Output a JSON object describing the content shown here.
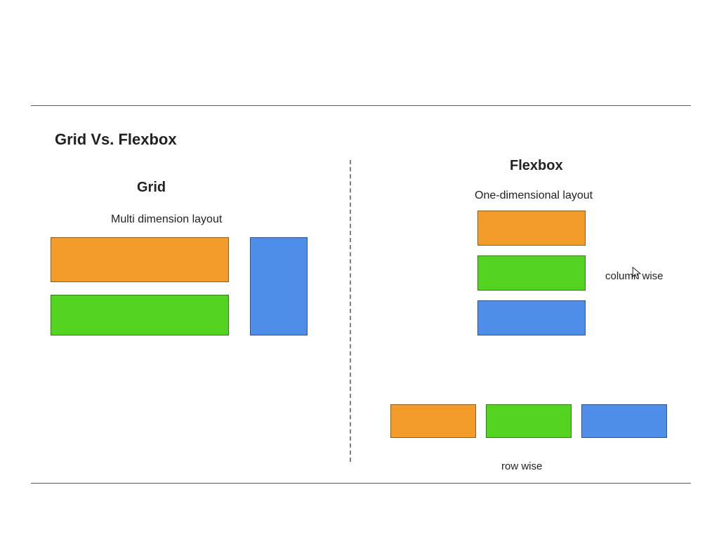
{
  "title": "Grid Vs. Flexbox",
  "grid": {
    "heading": "Grid",
    "subheading": "Multi dimension layout",
    "boxes": [
      {
        "color": "orange",
        "role": "wide-top"
      },
      {
        "color": "green",
        "role": "wide-bottom"
      },
      {
        "color": "blue",
        "role": "tall-right"
      }
    ]
  },
  "flexbox": {
    "heading": "Flexbox",
    "subheading": "One-dimensional layout",
    "column": {
      "label": "column wise",
      "boxes": [
        {
          "color": "orange"
        },
        {
          "color": "green"
        },
        {
          "color": "blue"
        }
      ]
    },
    "row": {
      "label": "row wise",
      "boxes": [
        {
          "color": "orange"
        },
        {
          "color": "green"
        },
        {
          "color": "blue"
        }
      ]
    }
  },
  "colors": {
    "orange": "#f29c2b",
    "green": "#54d421",
    "blue": "#4f8ee8",
    "line": "#5b5b5b"
  }
}
